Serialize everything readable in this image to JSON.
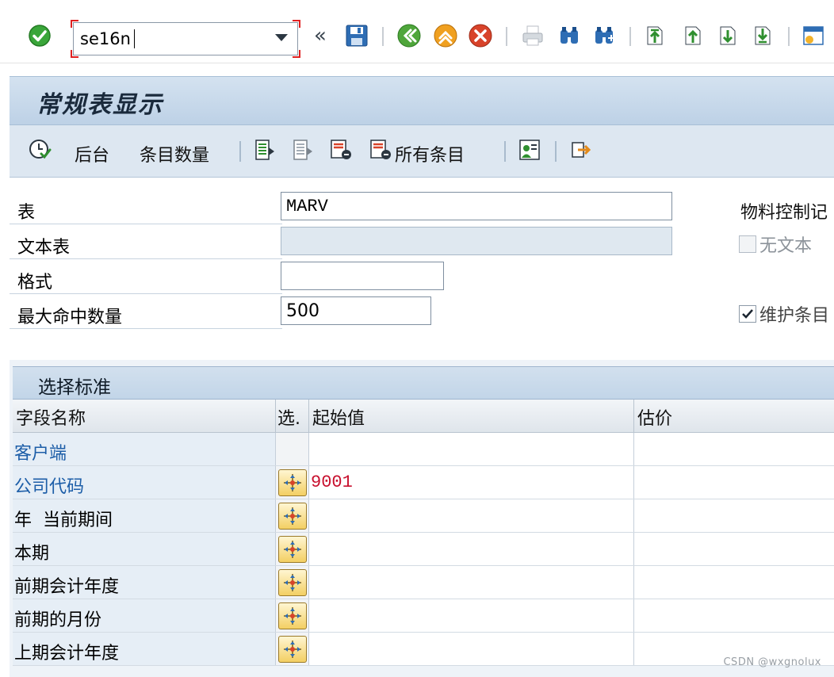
{
  "system_toolbar": {
    "command_value": "se16n"
  },
  "title": "常规表显示",
  "app_toolbar": {
    "background_label": "后台",
    "count_label": "条目数量",
    "all_entries_label": "所有条目"
  },
  "form": {
    "fields": [
      {
        "label": "表",
        "value": "MARV"
      },
      {
        "label": "文本表",
        "value": ""
      },
      {
        "label": "格式",
        "value": ""
      },
      {
        "label": "最大命中数量",
        "value": "500"
      }
    ],
    "side_title": "物料控制记",
    "no_text_label": "无文本",
    "no_text_checked": false,
    "maintain_label": "维护条目",
    "maintain_checked": true
  },
  "selection": {
    "title": "选择标准",
    "columns": [
      "字段名称",
      "选.",
      "起始值",
      "估价"
    ],
    "rows": [
      {
        "name": "客户端",
        "value": "",
        "has_button": false
      },
      {
        "name": "公司代码",
        "value": "9001",
        "has_button": true
      },
      {
        "name": "年  当前期间",
        "value": "",
        "has_button": true
      },
      {
        "name": "本期",
        "value": "",
        "has_button": true
      },
      {
        "name": "前期会计年度",
        "value": "",
        "has_button": true
      },
      {
        "name": "前期的月份",
        "value": "",
        "has_button": true
      },
      {
        "name": "上期会计年度",
        "value": "",
        "has_button": true
      }
    ]
  },
  "watermark": "CSDN @wxgnolux",
  "colors": {
    "title_bar": "#c7d9eb",
    "accent_blue": "#1d5ea8",
    "value_red": "#c8102e",
    "ok_green": "#3aa63a",
    "highlight_red": "#e02020"
  }
}
